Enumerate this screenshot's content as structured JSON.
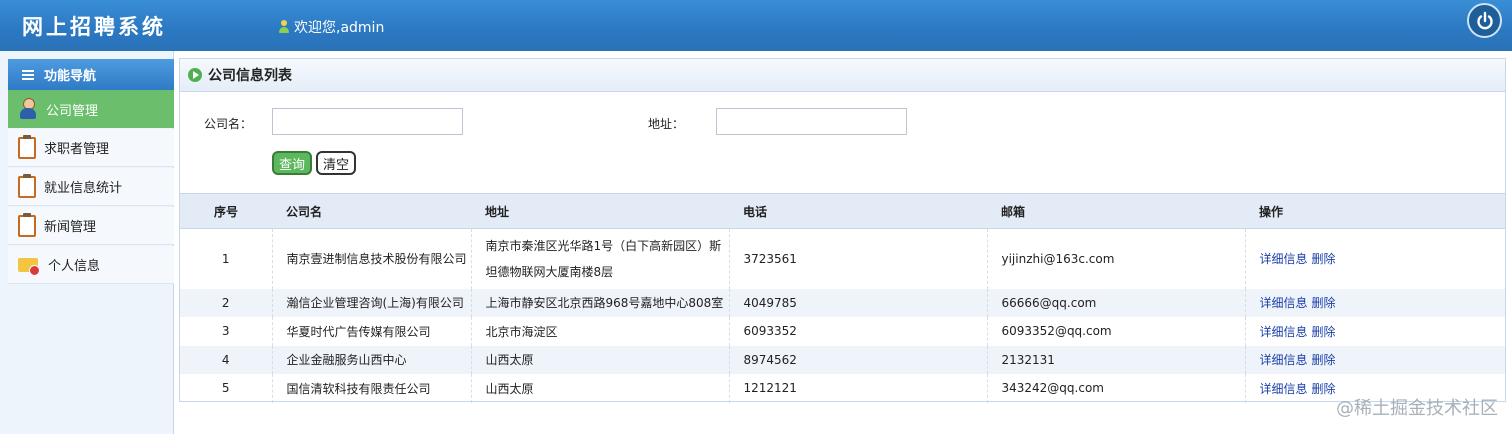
{
  "header": {
    "app_title": "网上招聘系统",
    "welcome": "欢迎您,admin",
    "accent_color": "#2b78c2"
  },
  "sidebar": {
    "title": "功能导航",
    "items": [
      {
        "label": "公司管理",
        "icon": "person-icon",
        "active": true
      },
      {
        "label": "求职者管理",
        "icon": "clipboard-icon",
        "active": false
      },
      {
        "label": "就业信息统计",
        "icon": "clipboard-icon",
        "active": false
      },
      {
        "label": "新闻管理",
        "icon": "clipboard-icon",
        "active": false
      },
      {
        "label": "个人信息",
        "icon": "folder-user-icon",
        "active": false
      }
    ]
  },
  "main": {
    "title": "公司信息列表",
    "search": {
      "company_label": "公司名：",
      "company_value": "",
      "address_label": "地址：",
      "address_value": "",
      "query_label": "查询",
      "clear_label": "清空"
    },
    "table": {
      "columns": [
        "序号",
        "公司名",
        "地址",
        "电话",
        "邮箱",
        "操作"
      ],
      "rows": [
        {
          "no": "1",
          "name": "南京壹进制信息技术股份有限公司",
          "address": "南京市秦淮区光华路1号（白下高新园区）斯坦德物联网大厦南楼8层",
          "phone": "3723561",
          "email": "yijinzhi@163c.com"
        },
        {
          "no": "2",
          "name": "瀚信企业管理咨询(上海)有限公司",
          "address": "上海市静安区北京西路968号嘉地中心808室",
          "phone": "4049785",
          "email": "66666@qq.com"
        },
        {
          "no": "3",
          "name": "华夏时代广告传媒有限公司",
          "address": "北京市海淀区",
          "phone": "6093352",
          "email": "6093352@qq.com"
        },
        {
          "no": "4",
          "name": "企业金融服务山西中心",
          "address": "山西太原",
          "phone": "8974562",
          "email": "2132131"
        },
        {
          "no": "5",
          "name": "国信清软科技有限责任公司",
          "address": "山西太原",
          "phone": "1212121",
          "email": "343242@qq.com"
        }
      ],
      "action_detail": "详细信息",
      "action_delete": "删除"
    }
  },
  "watermark": "@稀土掘金技术社区"
}
